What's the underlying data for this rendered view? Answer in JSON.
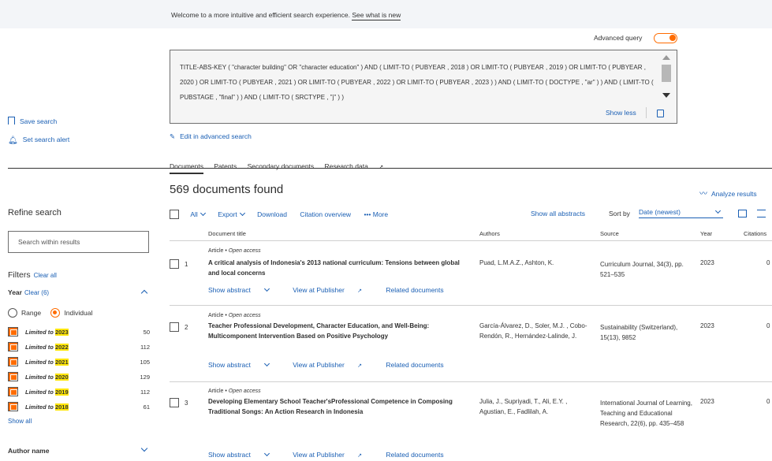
{
  "banner": {
    "text": "Welcome to a more intuitive and efficient search experience.",
    "link": "See what is new"
  },
  "advanced_query": {
    "label": "Advanced query",
    "enabled": true
  },
  "query": {
    "text": "TITLE-ABS-KEY ( \"character building\" OR \"character education\" ) AND ( LIMIT-TO ( PUBYEAR , 2018 ) OR LIMIT-TO ( PUBYEAR , 2019 ) OR LIMIT-TO ( PUBYEAR , 2020 ) OR LIMIT-TO ( PUBYEAR , 2021 ) OR LIMIT-TO ( PUBYEAR , 2022 ) OR LIMIT-TO ( PUBYEAR , 2023 ) ) AND ( LIMIT-TO ( DOCTYPE , \"ar\" ) ) AND ( LIMIT-TO ( PUBSTAGE , \"final\" ) ) AND ( LIMIT-TO ( SRCTYPE , \"j\" ) )",
    "show_less": "Show less",
    "edit": "Edit in advanced search"
  },
  "side": {
    "save_search": "Save search",
    "set_alert": "Set search alert"
  },
  "tabs": [
    "Documents",
    "Patents",
    "Secondary documents",
    "Research data"
  ],
  "results": {
    "found": "569 documents found",
    "analyze": "Analyze results"
  },
  "refine": {
    "title": "Refine search",
    "search_placeholder": "Search within results",
    "filters": "Filters",
    "clear_all": "Clear all",
    "year_label": "Year",
    "year_clear": "Clear (6)",
    "range": "Range",
    "individual": "Individual",
    "limited_to": "Limited to",
    "years": [
      {
        "year": "2023",
        "count": "50"
      },
      {
        "year": "2022",
        "count": "112"
      },
      {
        "year": "2021",
        "count": "105"
      },
      {
        "year": "2020",
        "count": "129"
      },
      {
        "year": "2019",
        "count": "112"
      },
      {
        "year": "2018",
        "count": "61"
      }
    ],
    "show_all": "Show all",
    "author_name": "Author name"
  },
  "toolbar": {
    "all": "All",
    "export": "Export",
    "download": "Download",
    "citation_overview": "Citation overview",
    "more": "••• More",
    "show_all_abstracts": "Show all abstracts",
    "sort_by": "Sort by",
    "sort_value": "Date (newest)"
  },
  "columns": {
    "title": "Document title",
    "authors": "Authors",
    "source": "Source",
    "year": "Year",
    "citations": "Citations"
  },
  "row_actions": {
    "show_abstract": "Show abstract",
    "view_publisher": "View at Publisher",
    "related": "Related documents"
  },
  "documents": [
    {
      "num": "1",
      "type": "Article",
      "access": "Open access",
      "title": "A critical analysis of Indonesia's 2013 national curriculum: Tensions between global and local concerns",
      "authors": "Puad, L.M.A.Z., Ashton, K.",
      "source": "Curriculum Journal, 34(3), pp. 521–535",
      "year": "2023",
      "citations": "0"
    },
    {
      "num": "2",
      "type": "Article",
      "access": "Open access",
      "title": "Teacher Professional Development, Character Education, and Well-Being: Multicomponent Intervention Based on Positive Psychology",
      "authors": "García-Álvarez, D., Soler, M.J. , Cobo-Rendón, R., Hernández-Lalinde, J.",
      "source": "Sustainability (Switzerland), 15(13), 9852",
      "year": "2023",
      "citations": "0"
    },
    {
      "num": "3",
      "type": "Article",
      "access": "Open access",
      "title": "Developing Elementary School Teacher'sProfessional Competence in Composing Traditional Songs: An Action Research in Indonesia",
      "authors": "Julia, J., Supriyadi, T., Ali, E.Y. , Agustian, E., Fadlilah, A.",
      "source": "International Journal of Learning, Teaching and Educational Research, 22(6), pp. 435–458",
      "year": "2023",
      "citations": "0"
    }
  ],
  "colors": {
    "accent": "#1a5fb4",
    "orange": "#ff6c00",
    "highlight": "#ffe600"
  }
}
